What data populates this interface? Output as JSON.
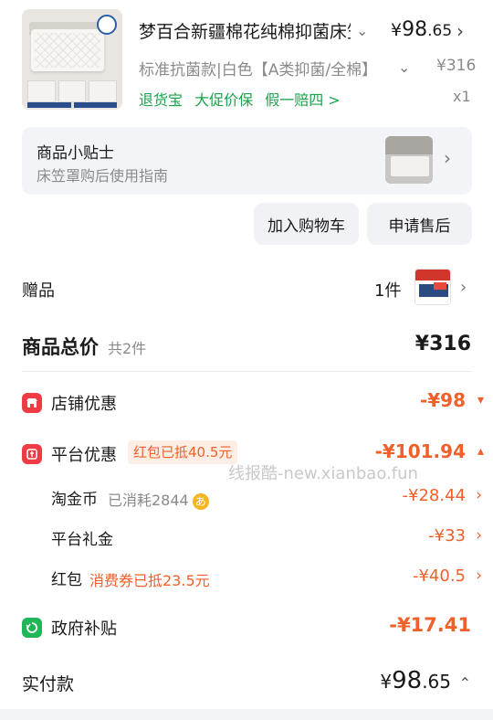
{
  "product": {
    "title": "梦百合新疆棉花纯棉抑菌床笠",
    "price_symbol": "¥",
    "price_int": "98",
    "price_dec": ".65",
    "spec": "标准抗菌款|白色【A类抑菌/全棉】",
    "spec_price": "¥316",
    "services": [
      "退货宝",
      "大促价保",
      "假一赔四 >"
    ],
    "qty": "x1"
  },
  "tips": {
    "title": "商品小贴士",
    "subtitle": "床笠罩购后使用指南"
  },
  "buttons": {
    "add_cart": "加入购物车",
    "after_sale": "申请售后"
  },
  "gift": {
    "label": "赠品",
    "count": "1件"
  },
  "total": {
    "label": "商品总价",
    "sub": "共2件",
    "value": "¥316"
  },
  "discounts": {
    "store": {
      "label": "店铺优惠",
      "value": "-¥98"
    },
    "platform": {
      "label": "平台优惠",
      "tag": "红包已抵40.5元",
      "value": "-¥101.94"
    },
    "gold_coin": {
      "label": "淘金币",
      "note": "已消耗2844",
      "coin_glyph": "あ",
      "value": "-¥28.44"
    },
    "platform_gift": {
      "label": "平台礼金",
      "value": "-¥33"
    },
    "hongbao": {
      "label": "红包",
      "note": "消费券已抵23.5元",
      "value": "-¥40.5"
    },
    "gov": {
      "label": "政府补贴",
      "value": "-¥17.41"
    }
  },
  "watermark": "线报酷-new.xianbao.fun",
  "pay": {
    "label": "实付款",
    "symbol": "¥",
    "int": "98",
    "dec": ".65"
  },
  "colors": {
    "accent_orange": "#f0602a",
    "green": "#1aa34a",
    "red_icon": "#f03a44",
    "green_icon": "#20b657"
  }
}
